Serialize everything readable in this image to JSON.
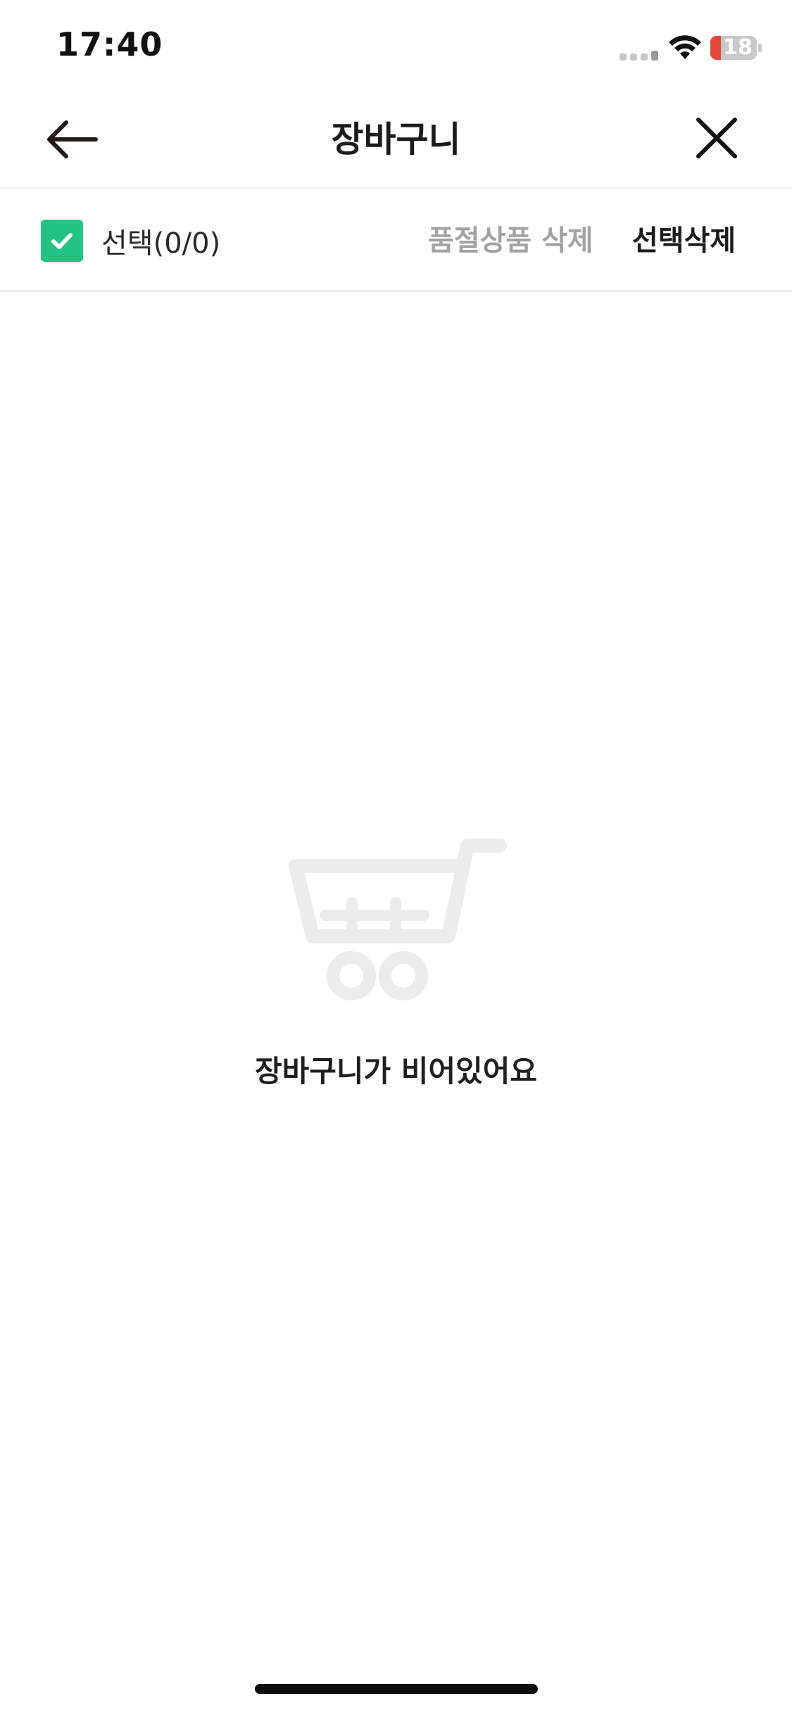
{
  "status_bar": {
    "time": "17:40",
    "battery_level": "18",
    "icons": [
      "signal-icon",
      "wifi-icon",
      "battery-icon"
    ],
    "battery_color": "#e5463b"
  },
  "header": {
    "title": "장바구니",
    "back_icon": "arrow-left-icon",
    "close_icon": "close-icon"
  },
  "select_bar": {
    "select_all_label": "선택(0/0)",
    "select_all_checked": true,
    "delete_soldout_label": "품절상품 삭제",
    "delete_selected_label": "선택삭제",
    "checkbox_color": "#23c483"
  },
  "empty_state": {
    "icon": "shopping-cart-icon",
    "message": "장바구니가 비어있어요"
  }
}
